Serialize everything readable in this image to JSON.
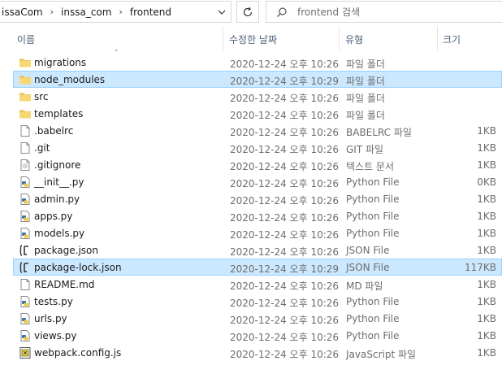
{
  "address": {
    "crumbs": [
      "issaCom",
      "inssa_com",
      "frontend"
    ]
  },
  "search": {
    "placeholder": "frontend 검색"
  },
  "columns": {
    "name": "이름",
    "date": "수정한 날짜",
    "type": "유형",
    "size": "크기"
  },
  "files": [
    {
      "name": "migrations",
      "date": "2020-12-24 오후 10:26",
      "type": "파일 폴더",
      "size": "",
      "icon": "folder-icon"
    },
    {
      "name": "node_modules",
      "date": "2020-12-24 오후 10:29",
      "type": "파일 폴더",
      "size": "",
      "icon": "folder-icon",
      "selected": true
    },
    {
      "name": "src",
      "date": "2020-12-24 오후 10:26",
      "type": "파일 폴더",
      "size": "",
      "icon": "folder-icon"
    },
    {
      "name": "templates",
      "date": "2020-12-24 오후 10:26",
      "type": "파일 폴더",
      "size": "",
      "icon": "folder-icon"
    },
    {
      "name": ".babelrc",
      "date": "2020-12-24 오후 10:26",
      "type": "BABELRC 파일",
      "size": "1KB",
      "icon": "blank-file-icon"
    },
    {
      "name": ".git",
      "date": "2020-12-24 오후 10:26",
      "type": "GIT 파일",
      "size": "1KB",
      "icon": "blank-file-icon"
    },
    {
      "name": ".gitignore",
      "date": "2020-12-24 오후 10:26",
      "type": "텍스트 문서",
      "size": "1KB",
      "icon": "text-file-icon"
    },
    {
      "name": "__init__.py",
      "date": "2020-12-24 오후 10:26",
      "type": "Python File",
      "size": "0KB",
      "icon": "python-file-icon"
    },
    {
      "name": "admin.py",
      "date": "2020-12-24 오후 10:26",
      "type": "Python File",
      "size": "1KB",
      "icon": "python-file-icon"
    },
    {
      "name": "apps.py",
      "date": "2020-12-24 오후 10:26",
      "type": "Python File",
      "size": "1KB",
      "icon": "python-file-icon"
    },
    {
      "name": "models.py",
      "date": "2020-12-24 오후 10:26",
      "type": "Python File",
      "size": "1KB",
      "icon": "python-file-icon"
    },
    {
      "name": "package.json",
      "date": "2020-12-24 오후 10:26",
      "type": "JSON File",
      "size": "1KB",
      "icon": "json-file-icon"
    },
    {
      "name": "package-lock.json",
      "date": "2020-12-24 오후 10:29",
      "type": "JSON File",
      "size": "117KB",
      "icon": "json-file-icon",
      "selected": true
    },
    {
      "name": "README.md",
      "date": "2020-12-24 오후 10:26",
      "type": "MD 파일",
      "size": "1KB",
      "icon": "blank-file-icon"
    },
    {
      "name": "tests.py",
      "date": "2020-12-24 오후 10:26",
      "type": "Python File",
      "size": "1KB",
      "icon": "python-file-icon"
    },
    {
      "name": "urls.py",
      "date": "2020-12-24 오후 10:26",
      "type": "Python File",
      "size": "1KB",
      "icon": "python-file-icon"
    },
    {
      "name": "views.py",
      "date": "2020-12-24 오후 10:26",
      "type": "Python File",
      "size": "1KB",
      "icon": "python-file-icon"
    },
    {
      "name": "webpack.config.js",
      "date": "2020-12-24 오후 10:26",
      "type": "JavaScript 파일",
      "size": "1KB",
      "icon": "javascript-file-icon"
    }
  ]
}
